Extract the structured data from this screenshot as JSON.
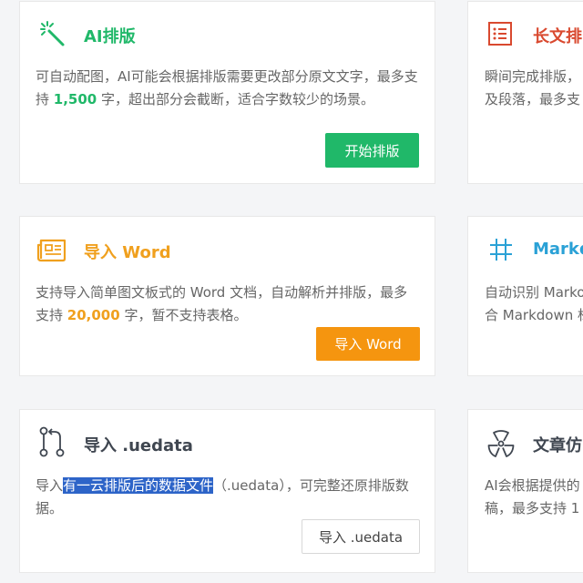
{
  "colors": {
    "green": "#20b869",
    "red": "#d9492f",
    "orange": "#f0a01e",
    "blue": "#2aa1d6",
    "dark": "#3f4650"
  },
  "cards": {
    "ai_layout": {
      "icon": "magic-wand-icon",
      "title": "AI排版",
      "desc_pre": "可自动配图，AI可能会根据排版需要更改部分原文文字，最多支持 ",
      "desc_num": "1,500",
      "desc_post": " 字，超出部分会截断，适合字数较少的场景。",
      "button": "开始排版"
    },
    "long_text": {
      "icon": "list-doc-icon",
      "title": "长文排",
      "desc_l1": "瞬间完成排版，",
      "desc_l2": "及段落，最多支"
    },
    "import_word": {
      "icon": "newspaper-icon",
      "title": "导入 Word",
      "desc_pre": "支持导入简单图文板式的 Word 文档，自动解析并排版，最多支持 ",
      "desc_num": "20,000",
      "desc_post": " 字，暂不支持表格。",
      "button": "导入 Word"
    },
    "markdown": {
      "icon": "hash-icon",
      "title": "Markd",
      "desc_l1": "自动识别 Marko",
      "desc_l2": "合 Markdown 标"
    },
    "import_uedata": {
      "icon": "git-branch-icon",
      "title": "导入 .uedata",
      "desc_pre": "导入",
      "desc_selected": "有一云排版后的数据文件",
      "desc_post": "（.uedata），可完整还原排版数据。",
      "button": "导入 .uedata"
    },
    "article_imitate": {
      "icon": "radiation-icon",
      "title": "文章仿",
      "desc_l1": "AI会根据提供的",
      "desc_l2": "稿，最多支持 1"
    }
  }
}
